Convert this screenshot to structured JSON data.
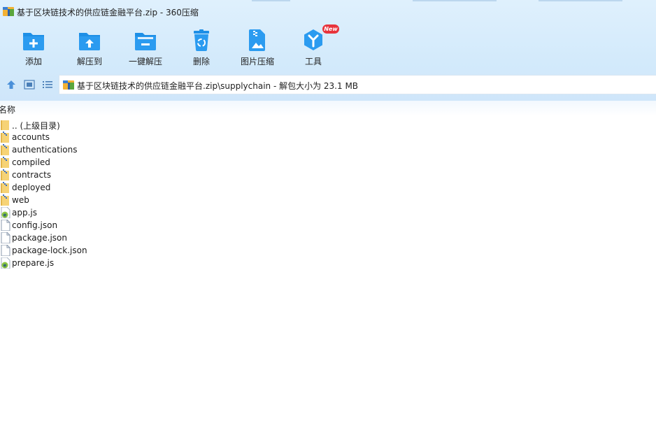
{
  "window": {
    "title": "基于区块链技术的供应链金融平台.zip - 360压缩"
  },
  "toolbar": {
    "add_label": "添加",
    "extract_to_label": "解压到",
    "one_click_extract_label": "一键解压",
    "delete_label": "删除",
    "image_compress_label": "图片压缩",
    "tools_label": "工具",
    "tools_badge": "New",
    "icon_color": "#1e8fe6",
    "badge_color": "#e8343c"
  },
  "navigation": {
    "up_icon": "up-arrow-icon",
    "thumbnail_view_icon": "thumbnail-view-icon",
    "list_view_icon": "list-view-icon",
    "path": "基于区块链技术的供应链金融平台.zip\\supplychain - 解包大小为 23.1 MB"
  },
  "columns": {
    "name": "名称"
  },
  "files": [
    {
      "name": ".. (上级目录)",
      "type": "parent-folder"
    },
    {
      "name": "accounts",
      "type": "folder"
    },
    {
      "name": "authentications",
      "type": "folder"
    },
    {
      "name": "compiled",
      "type": "folder"
    },
    {
      "name": "contracts",
      "type": "folder"
    },
    {
      "name": "deployed",
      "type": "folder"
    },
    {
      "name": "web",
      "type": "folder"
    },
    {
      "name": "app.js",
      "type": "js"
    },
    {
      "name": "config.json",
      "type": "file"
    },
    {
      "name": "package.json",
      "type": "file"
    },
    {
      "name": "package-lock.json",
      "type": "file"
    },
    {
      "name": "prepare.js",
      "type": "js"
    }
  ]
}
